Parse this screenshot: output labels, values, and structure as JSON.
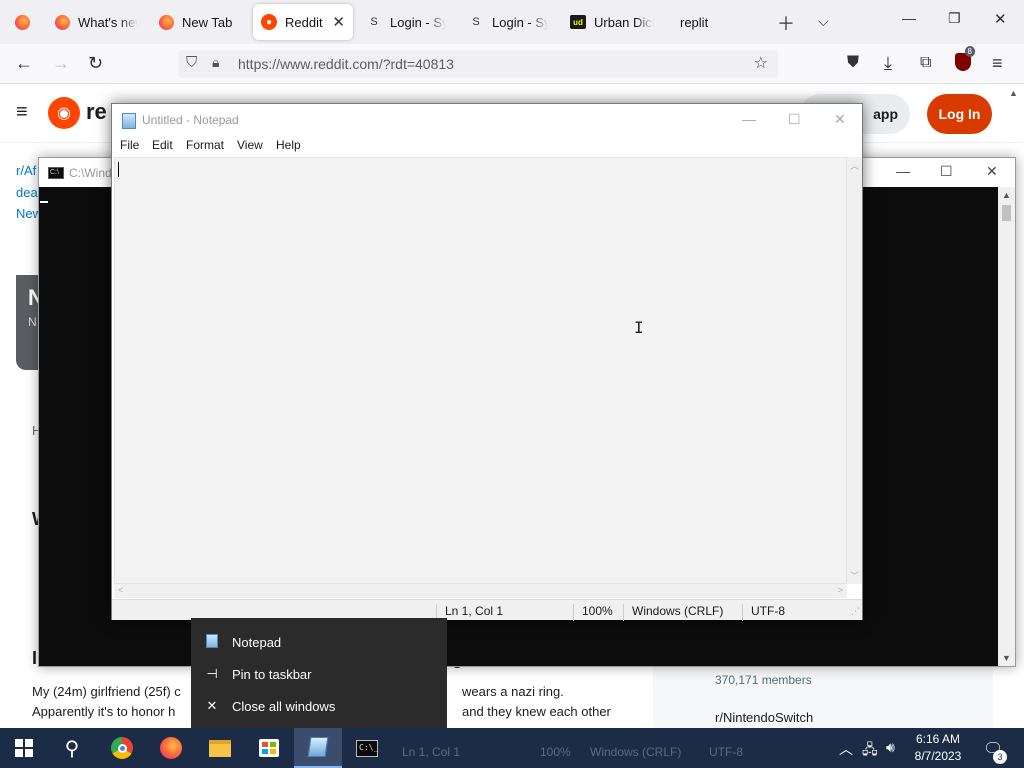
{
  "browser": {
    "tabs": [
      {
        "label": "What's new",
        "icon": "firefox-icon"
      },
      {
        "label": "New Tab",
        "icon": "firefox-icon"
      },
      {
        "label": "Reddit",
        "icon": "reddit-icon",
        "active": true
      },
      {
        "label": "Login - Sync",
        "icon": "sync-icon"
      },
      {
        "label": "Login - Sync",
        "icon": "sync-icon"
      },
      {
        "label": "Urban Dicti",
        "icon": "urban-dictionary-icon"
      },
      {
        "label": "replit",
        "icon": "none"
      }
    ],
    "url": "https://www.reddit.com/?rdt=40813",
    "extension_badge": "8"
  },
  "reddit": {
    "logo_text": "re",
    "get_app_label": "app",
    "login_label": "Log In",
    "sidebar_links": [
      "r/Af",
      "dea",
      "New"
    ],
    "card_big": "N",
    "card_small": "N",
    "misc_letter_h": "H",
    "misc_letter_w": "W",
    "post_title_start": "I",
    "post_title_end": "g",
    "post_body": [
      {
        "left": "My (24m) girlfriend (25f) c",
        "right": "wears a nazi ring."
      },
      {
        "left": "Apparently it's to honor h",
        "right": "and they knew each other"
      }
    ],
    "members": "370,171 members",
    "subreddit": "r/NintendoSwitch"
  },
  "console": {
    "title": "C:\\Wind"
  },
  "notepad": {
    "title": "Untitled - Notepad",
    "menu": [
      "File",
      "Edit",
      "Format",
      "View",
      "Help"
    ],
    "status": {
      "position": "Ln 1, Col 1",
      "zoom": "100%",
      "line_endings": "Windows (CRLF)",
      "encoding": "UTF-8"
    }
  },
  "jumplist": {
    "items": [
      {
        "label": "Notepad",
        "icon": "notepad-icon"
      },
      {
        "label": "Pin to taskbar",
        "icon": "pin-icon"
      },
      {
        "label": "Close all windows",
        "icon": "close-icon"
      }
    ]
  },
  "taskbar": {
    "ghost_status": [
      "Ln 1, Col 1",
      "100%",
      "Windows (CRLF)",
      "UTF-8"
    ],
    "time": "6:16 AM",
    "date": "8/7/2023",
    "notification_count": "3"
  },
  "colors": {
    "reddit_orange": "#ff4500",
    "login_button": "#d93a00",
    "taskbar": "#1c2c46",
    "jumplist": "#2b2b2b"
  }
}
